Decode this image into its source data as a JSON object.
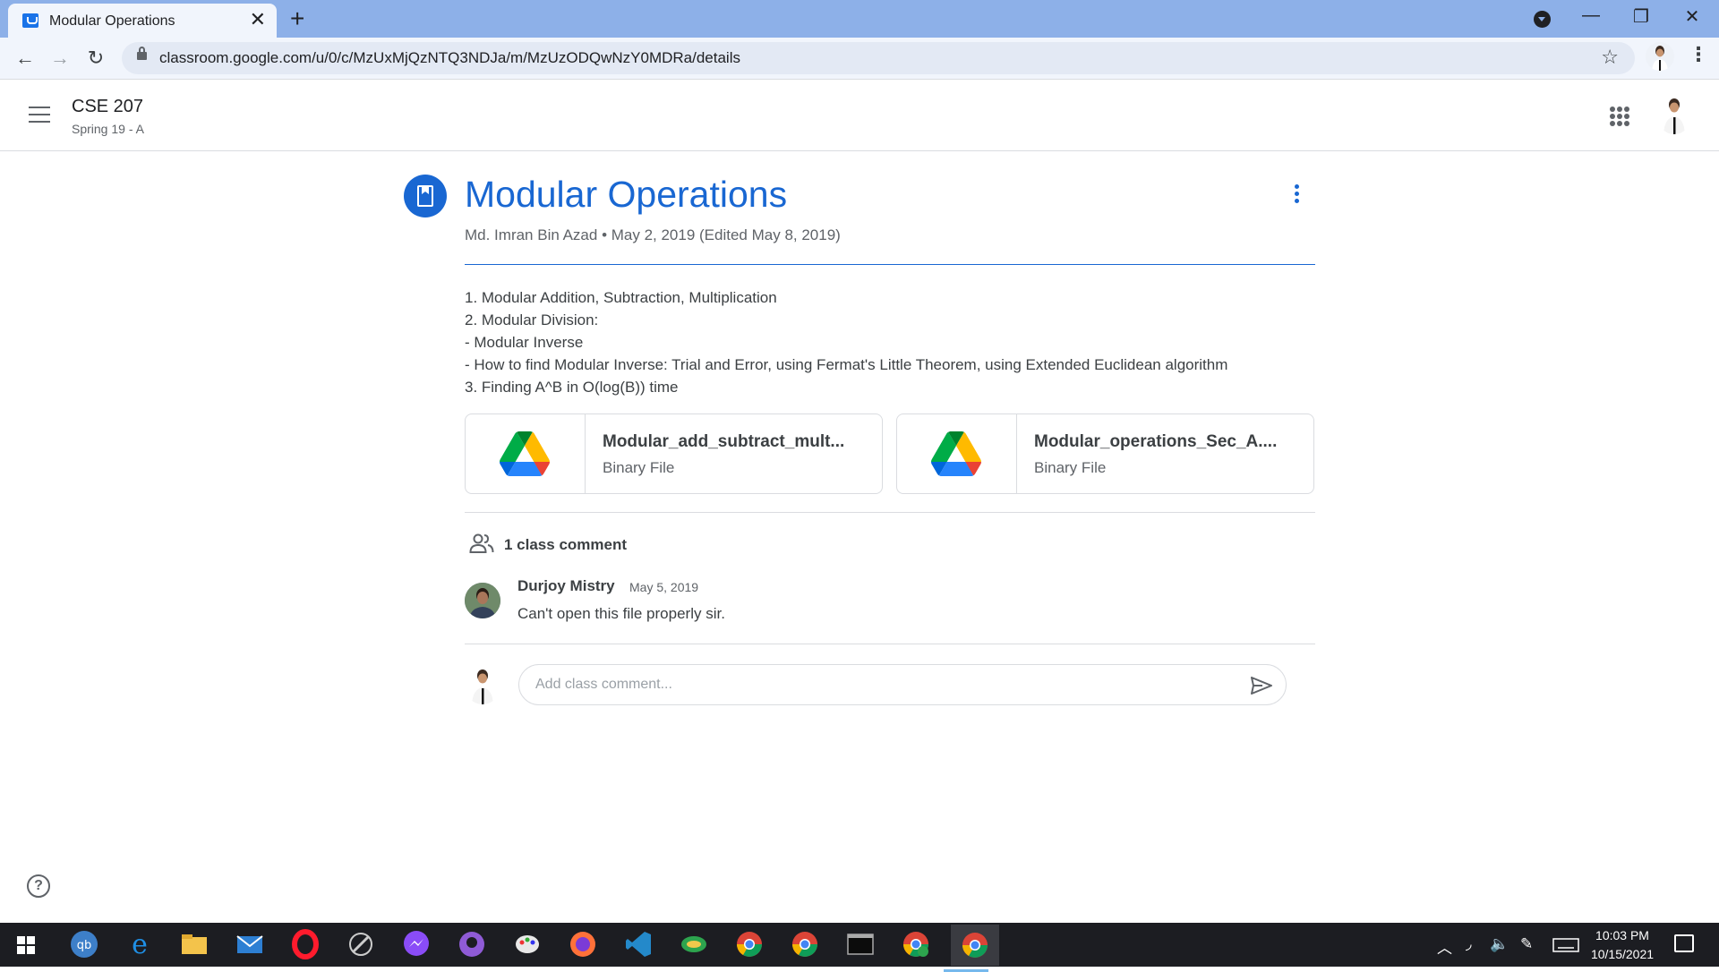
{
  "browser": {
    "tab_title": "Modular Operations",
    "tab_close": "✕",
    "new_tab": "+",
    "url": "classroom.google.com/u/0/c/MzUxMjQzNTQ3NDJa/m/MzUzODQwNzY0MDRa/details",
    "back": "←",
    "forward": "→",
    "reload": "↻",
    "star": "☆",
    "minimize": "—",
    "restore": "❐",
    "close": "✕",
    "menu": "⋮"
  },
  "header": {
    "course_title": "CSE 207",
    "course_section": "Spring 19 - A"
  },
  "post": {
    "title": "Modular Operations",
    "meta": "Md. Imran Bin Azad • May 2, 2019 (Edited May 8, 2019)",
    "description": [
      "1. Modular Addition, Subtraction, Multiplication",
      "2. Modular Division:",
      "- Modular Inverse",
      "- How to find Modular Inverse: Trial and Error, using Fermat's Little Theorem, using Extended Euclidean algorithm",
      "3. Finding A^B in O(log(B)) time"
    ],
    "attachments": [
      {
        "name": "Modular_add_subtract_mult...",
        "type": "Binary File"
      },
      {
        "name": "Modular_operations_Sec_A....",
        "type": "Binary File"
      }
    ]
  },
  "comments": {
    "count_label": "1 class comment",
    "items": [
      {
        "author": "Durjoy Mistry",
        "date": "May 5, 2019",
        "text": "Can't open this file properly sir."
      }
    ],
    "input_placeholder": "Add class comment..."
  },
  "help": "?",
  "taskbar": {
    "time": "10:03 PM",
    "date": "10/15/2021",
    "apps": [
      "qbittorrent-icon",
      "edge-icon",
      "file-explorer-icon",
      "mail-icon",
      "opera-icon",
      "inkscape-icon",
      "messenger-icon",
      "github-icon",
      "paint-icon",
      "firefox-icon",
      "vscode-icon",
      "app-icon",
      "chrome-icon",
      "chrome-icon",
      "terminal-icon",
      "chrome-profile-icon",
      "chrome-active-icon"
    ]
  },
  "colors": {
    "accent": "#1967d2",
    "chrome_tabstrip": "#8db0e8",
    "taskbar": "#1c1d22"
  }
}
